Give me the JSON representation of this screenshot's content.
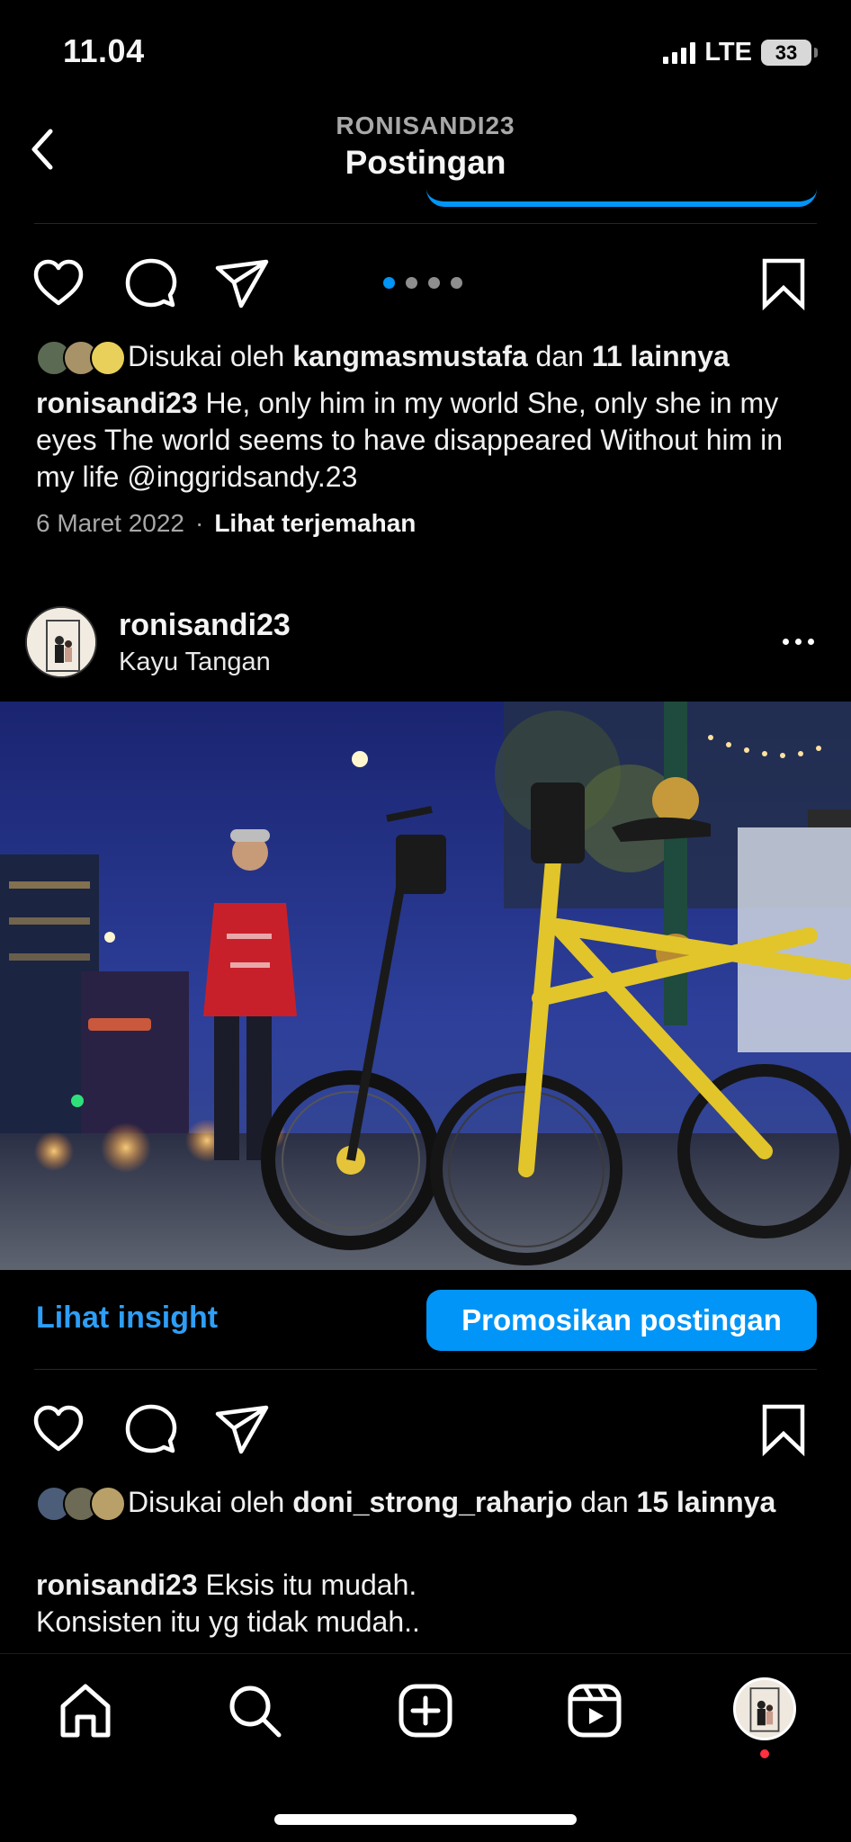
{
  "status_bar": {
    "time": "11.04",
    "network": "LTE",
    "battery": "33"
  },
  "header": {
    "username": "RONISANDI23",
    "title": "Postingan"
  },
  "post1": {
    "likes_prefix": "Disukai oleh ",
    "likes_user": "kangmasmustafa",
    "likes_mid": " dan ",
    "likes_count": "11 lainnya",
    "caption_user": "ronisandi23",
    "caption_text": " He, only him in my world She, only she in my eyes The world seems to have disappeared Without him in my life @inggridsandy.23",
    "date": "6 Maret 2022",
    "separator": "·",
    "translate": "Lihat terjemahan",
    "carousel_total": 4,
    "carousel_active": 1
  },
  "post2": {
    "username": "ronisandi23",
    "location": "Kayu Tangan",
    "insight_label": "Lihat insight",
    "promote_label": "Promosikan postingan",
    "likes_prefix": "Disukai oleh ",
    "likes_user": "doni_strong_raharjo",
    "likes_mid": " dan ",
    "likes_count": "15 lainnya",
    "caption_user": "ronisandi23",
    "caption_line1": " Eksis itu mudah.",
    "caption_line2": "Konsisten itu yg tidak mudah.."
  },
  "nav": {
    "items": [
      "home-icon",
      "search-icon",
      "create-icon",
      "reels-icon",
      "profile-avatar"
    ]
  },
  "colors": {
    "accent": "#0095f6",
    "link": "#2e9ef7",
    "notification": "#ff3040",
    "background": "#000000"
  }
}
